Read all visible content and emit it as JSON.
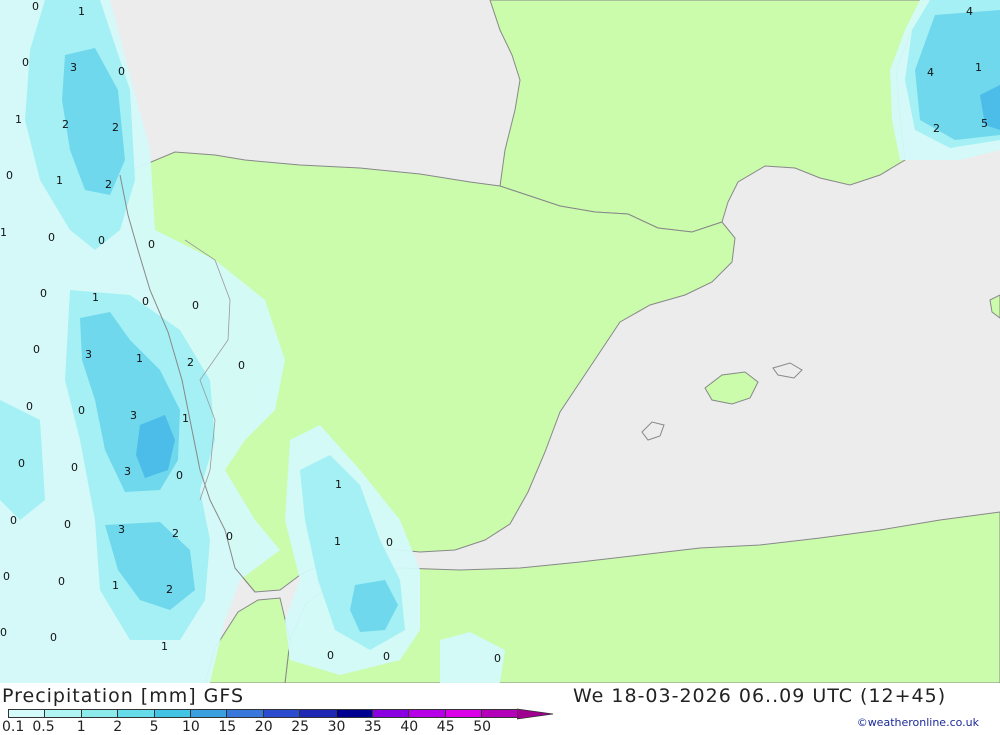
{
  "footer": {
    "title_left": "Precipitation [mm] GFS",
    "title_right": "We 18-03-2026 06..09 UTC (12+45)",
    "credit": "©weatheronline.co.uk"
  },
  "legend": {
    "labels": [
      "0.1",
      "0.5",
      "1",
      "2",
      "5",
      "10",
      "15",
      "20",
      "25",
      "30",
      "35",
      "40",
      "45",
      "50"
    ],
    "colors": [
      "#d4fafa",
      "#b0f4f4",
      "#8ceaea",
      "#66dcea",
      "#44c4e4",
      "#3ba0e0",
      "#3878dc",
      "#2c4cd0",
      "#1e28b4",
      "#000090",
      "#8a00e0",
      "#b800e8",
      "#dc00e8",
      "#b400b8",
      "#a00090"
    ]
  },
  "map": {
    "colors": {
      "sea": "#ececec",
      "land": "#cafcac",
      "coast": "#888888",
      "precip_light": "#d4fafa",
      "precip_medium": "#a4f0f4",
      "precip_heavy": "#70d8ec",
      "precip_heavier": "#4cbce8"
    },
    "labels": [
      "0",
      "1",
      "0",
      "3",
      "0",
      "1",
      "2",
      "2",
      "0",
      "1",
      "2",
      "1",
      "0",
      "0",
      "0",
      "0",
      "0",
      "1",
      "0",
      "0",
      "0",
      "3",
      "1",
      "2",
      "0",
      "0",
      "3",
      "1",
      "0",
      "0",
      "3",
      "0",
      "0",
      "0",
      "3",
      "2",
      "0",
      "0",
      "1",
      "2",
      "0",
      "1",
      "0",
      "1",
      "0",
      "1",
      "0",
      "0",
      "0",
      "0",
      "4",
      "4",
      "1",
      "2",
      "5"
    ]
  }
}
